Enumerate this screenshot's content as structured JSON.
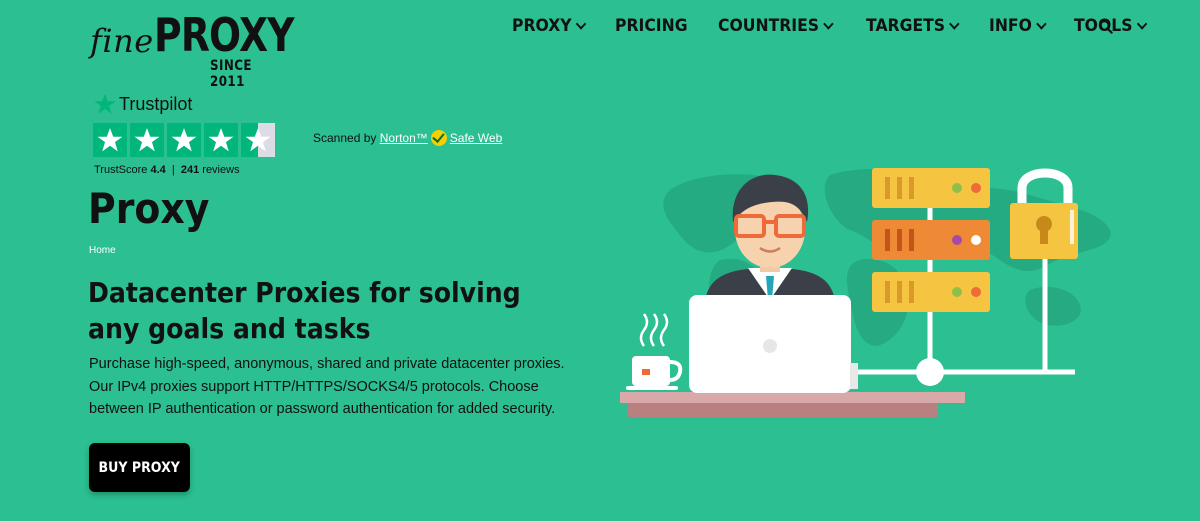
{
  "brand": {
    "fine": "fine",
    "proxy": "PROXY",
    "since": "SINCE 2011"
  },
  "nav": {
    "items": [
      {
        "label": "PROXY",
        "has_dropdown": true
      },
      {
        "label": "PRICING",
        "has_dropdown": false
      },
      {
        "label": "COUNTRIES",
        "has_dropdown": true
      },
      {
        "label": "TARGETS",
        "has_dropdown": true
      },
      {
        "label": "INFO",
        "has_dropdown": true
      },
      {
        "label": "TOOLS",
        "has_dropdown": true
      }
    ],
    "search_icon": "search-icon"
  },
  "trustpilot": {
    "logo_text": "Trustpilot",
    "score_label": "TrustScore",
    "score": "4.4",
    "separator": "|",
    "reviews_count": "241",
    "reviews_label": "reviews",
    "rating_stars": 4.5
  },
  "norton": {
    "prefix": "Scanned by",
    "brand": "Norton™",
    "suffix": "Safe Web"
  },
  "main": {
    "title": "Proxy",
    "breadcrumb": "Home",
    "headline": "Datacenter Proxies for solving any goals and tasks",
    "description": "Purchase high-speed, anonymous, shared and private datacenter proxies. Our IPv4 proxies support HTTP/HTTPS/SOCKS4/5 protocols. Choose between IP authentication or password authentication for added security.",
    "cta_label": "BUY PROXY"
  },
  "colors": {
    "background": "#2bbf91",
    "trustpilot_green": "#00b67a",
    "server_yellow": "#f5c441",
    "server_orange": "#ee8a35",
    "cta_bg": "#000000"
  }
}
